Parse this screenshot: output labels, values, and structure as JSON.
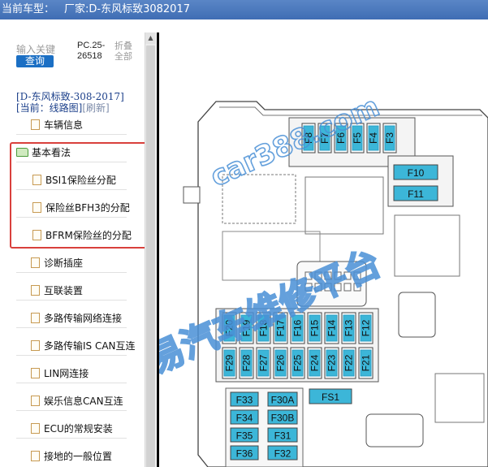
{
  "window": {
    "title": "当前车型：",
    "maker": "厂家:D-东风标致3082017"
  },
  "sidebar": {
    "search_placeholder": "输入关键",
    "search_button": "查询",
    "code": "PC.25-26518",
    "fold_label": "折叠全部",
    "path": "[D-东风标致-308-2017]",
    "view_current": "[当前：线路图]",
    "view_refresh": "[刷新]",
    "items": [
      {
        "label": "车辆信息"
      },
      {
        "label": "基本看法"
      },
      {
        "label": "BSI1保险丝分配"
      },
      {
        "label": "保险丝BFH3的分配"
      },
      {
        "label": "BFRM保险丝的分配"
      },
      {
        "label": "诊断插座"
      },
      {
        "label": "互联装置"
      },
      {
        "label": "多路传输网络连接"
      },
      {
        "label": "多路传输IS CAN互连"
      },
      {
        "label": "LIN网连接"
      },
      {
        "label": "娱乐信息CAN互连"
      },
      {
        "label": "ECU的常规安装"
      },
      {
        "label": "接地的一般位置"
      }
    ]
  },
  "diagram": {
    "top_fuses": [
      "F8",
      "F7",
      "F6",
      "F5",
      "F4",
      "F3"
    ],
    "side_fuses": [
      "F10",
      "F11"
    ],
    "row1": [
      "F20",
      "F19",
      "F18",
      "F17",
      "F16",
      "F15",
      "F14",
      "F13",
      "F12"
    ],
    "row2": [
      "F29",
      "F28",
      "F27",
      "F26",
      "F25",
      "F24",
      "F23",
      "F22",
      "F21"
    ],
    "col_a": [
      "F33",
      "F34",
      "F35",
      "F36"
    ],
    "col_b": [
      "F30A",
      "F30B",
      "F31",
      "F32"
    ],
    "fs": "FS1",
    "watermark_url": "car388.com",
    "watermark_text": "易汽车维修平台",
    "colors": {
      "fuse": "#3cb6d8",
      "fuse_dark": "#2a9ec3",
      "line": "#444444",
      "watermark": "#4a90d6"
    }
  }
}
